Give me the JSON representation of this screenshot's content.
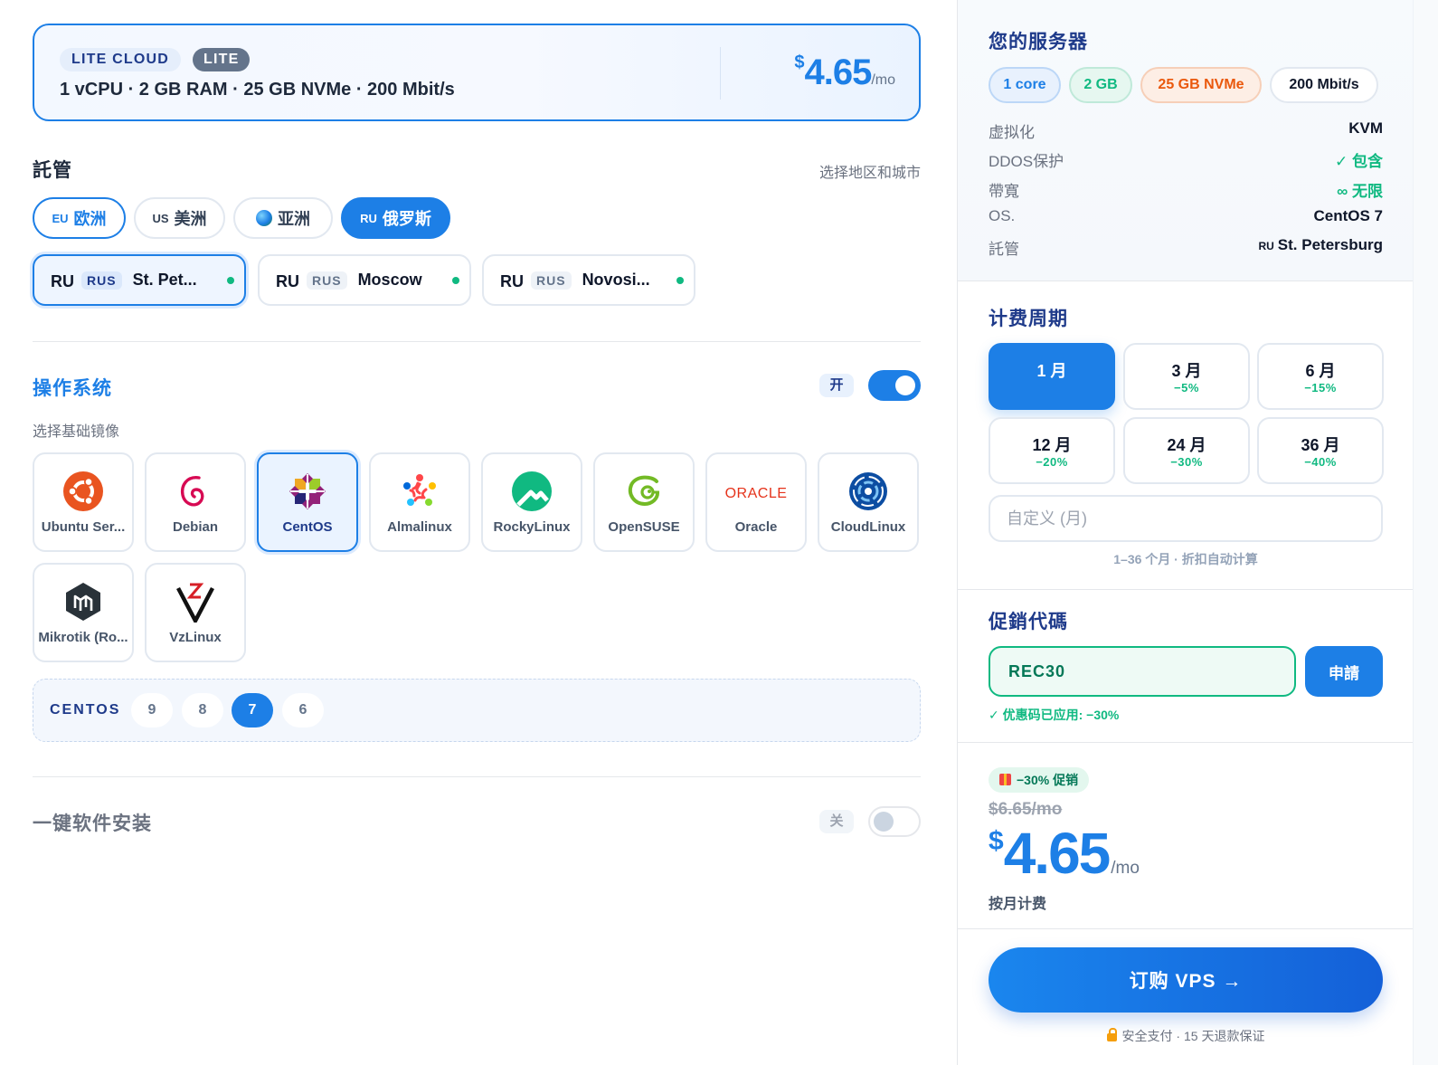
{
  "plan": {
    "tag_cloud": "LITE CLOUD",
    "tag_lite": "LITE",
    "specs": "1 vCPU · 2 GB RAM · 25 GB NVMe · 200 Mbit/s",
    "price_currency": "$",
    "price_amount": "4.65",
    "price_period": "/mo"
  },
  "hosting": {
    "title": "託管",
    "hint": "选择地区和城市",
    "regions": [
      {
        "code": "EU",
        "label": "欧洲"
      },
      {
        "code": "US",
        "label": "美洲"
      },
      {
        "code": "",
        "label": "亚洲",
        "icon": "globe-icon"
      },
      {
        "code": "RU",
        "label": "俄罗斯",
        "selected": true
      }
    ],
    "cities": [
      {
        "cc": "RU",
        "badge": "RUS",
        "name": "St. Pet...",
        "selected": true,
        "status": "online"
      },
      {
        "cc": "RU",
        "badge": "RUS",
        "name": "Moscow",
        "status": "online"
      },
      {
        "cc": "RU",
        "badge": "RUS",
        "name": "Novosi...",
        "status": "online"
      }
    ]
  },
  "os": {
    "title": "操作系统",
    "toggle_label": "开",
    "toggle_on": true,
    "subtitle": "选择基础镜像",
    "items": [
      {
        "label": "Ubuntu Ser...",
        "icon": "ubuntu-icon"
      },
      {
        "label": "Debian",
        "icon": "debian-icon"
      },
      {
        "label": "CentOS",
        "icon": "centos-icon",
        "selected": true
      },
      {
        "label": "Almalinux",
        "icon": "almalinux-icon"
      },
      {
        "label": "RockyLinux",
        "icon": "rockylinux-icon"
      },
      {
        "label": "OpenSUSE",
        "icon": "opensuse-icon"
      },
      {
        "label": "Oracle",
        "icon": "oracle-icon",
        "logo_text": "ORACLE"
      },
      {
        "label": "CloudLinux",
        "icon": "cloudlinux-icon"
      },
      {
        "label": "Mikrotik (Ro...",
        "icon": "mikrotik-icon"
      },
      {
        "label": "VzLinux",
        "icon": "vzlinux-icon"
      }
    ],
    "versions_title": "CENTOS",
    "versions": [
      "9",
      "8",
      "7",
      "6"
    ],
    "selected_version": "7"
  },
  "software": {
    "title": "一键软件安装",
    "toggle_label": "关",
    "toggle_on": false
  },
  "summary": {
    "title": "您的服务器",
    "chips": [
      {
        "label": "1 core",
        "color": "#1d7fe6"
      },
      {
        "label": "2 GB",
        "color": "#10b981"
      },
      {
        "label": "25 GB NVMe",
        "color": "#ea580c"
      },
      {
        "label": "200 Mbit/s",
        "color": "#0f172a"
      }
    ],
    "rows": [
      {
        "key": "虚拟化",
        "value": "KVM"
      },
      {
        "key": "DDOS保护",
        "value": "✓ 包含"
      },
      {
        "key": "帶寬",
        "value": "∞ 无限"
      },
      {
        "key": "OS.",
        "value": "CentOS 7"
      },
      {
        "key": "託管",
        "value_prefix": "RU",
        "value": "St. Petersburg"
      }
    ]
  },
  "billing": {
    "title": "计费周期",
    "terms": [
      {
        "months": "1 月",
        "discount": "",
        "selected": true
      },
      {
        "months": "3 月",
        "discount": "−5%"
      },
      {
        "months": "6 月",
        "discount": "−15%"
      },
      {
        "months": "12 月",
        "discount": "−20%"
      },
      {
        "months": "24 月",
        "discount": "−30%"
      },
      {
        "months": "36 月",
        "discount": "−40%"
      }
    ],
    "custom_placeholder": "自定义 (月)",
    "note": "1–36 个月 · 折扣自动计算"
  },
  "promo": {
    "title": "促銷代碼",
    "value": "REC30",
    "apply_label": "申請",
    "message": "✓ 优惠码已应用: −30%"
  },
  "total": {
    "badge": "−30% 促销",
    "old_price": "$6.65/mo",
    "currency": "$",
    "amount": "4.65",
    "period": "/mo",
    "billing_note": "按月计费",
    "order_label": "订购 VPS →",
    "secure_note": "安全支付 · 15 天退款保证"
  },
  "colors": {
    "accent": "#1d7fe6",
    "success": "#10b981",
    "warning": "#ea580c"
  }
}
